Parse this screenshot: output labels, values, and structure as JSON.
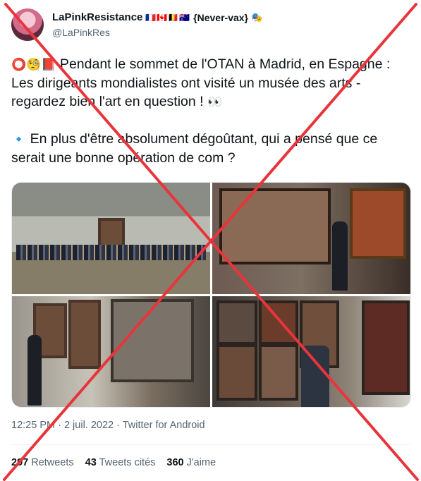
{
  "author": {
    "display_name": "LaPinkResistance",
    "flags": "🇫🇷🇨🇦🇧🇪🇦🇺",
    "tag": "{Never-vax}",
    "tag_emoji": "🎭",
    "handle": "@LaPinkRes"
  },
  "tweet": {
    "line1_emojis": "⭕🧐📕",
    "line1_text": " Pendant le sommet de l'OTAN à Madrid, en Espagne : Les dirigeants mondialistes ont visité  un musée des arts - regardez bien l'art en question  ! ",
    "line1_end_emoji": "👀",
    "line2_emoji": "🔹",
    "line2_text": "  En plus d'être absolument dégoûtant, qui a pensé que ce serait une bonne opération de com    ?"
  },
  "meta": {
    "time": "12:25 PM",
    "sep1": " · ",
    "date": "2 juil. 2022",
    "sep2": " · ",
    "source": "Twitter for Android"
  },
  "stats": {
    "retweets_count": "297",
    "retweets_label": "Retweets",
    "quotes_count": "43",
    "quotes_label": "Tweets cités",
    "likes_count": "360",
    "likes_label": "J'aime"
  },
  "colors": {
    "cross": "#e8343a",
    "muted_text": "#536471"
  },
  "icons": {
    "more": "more-icon"
  }
}
